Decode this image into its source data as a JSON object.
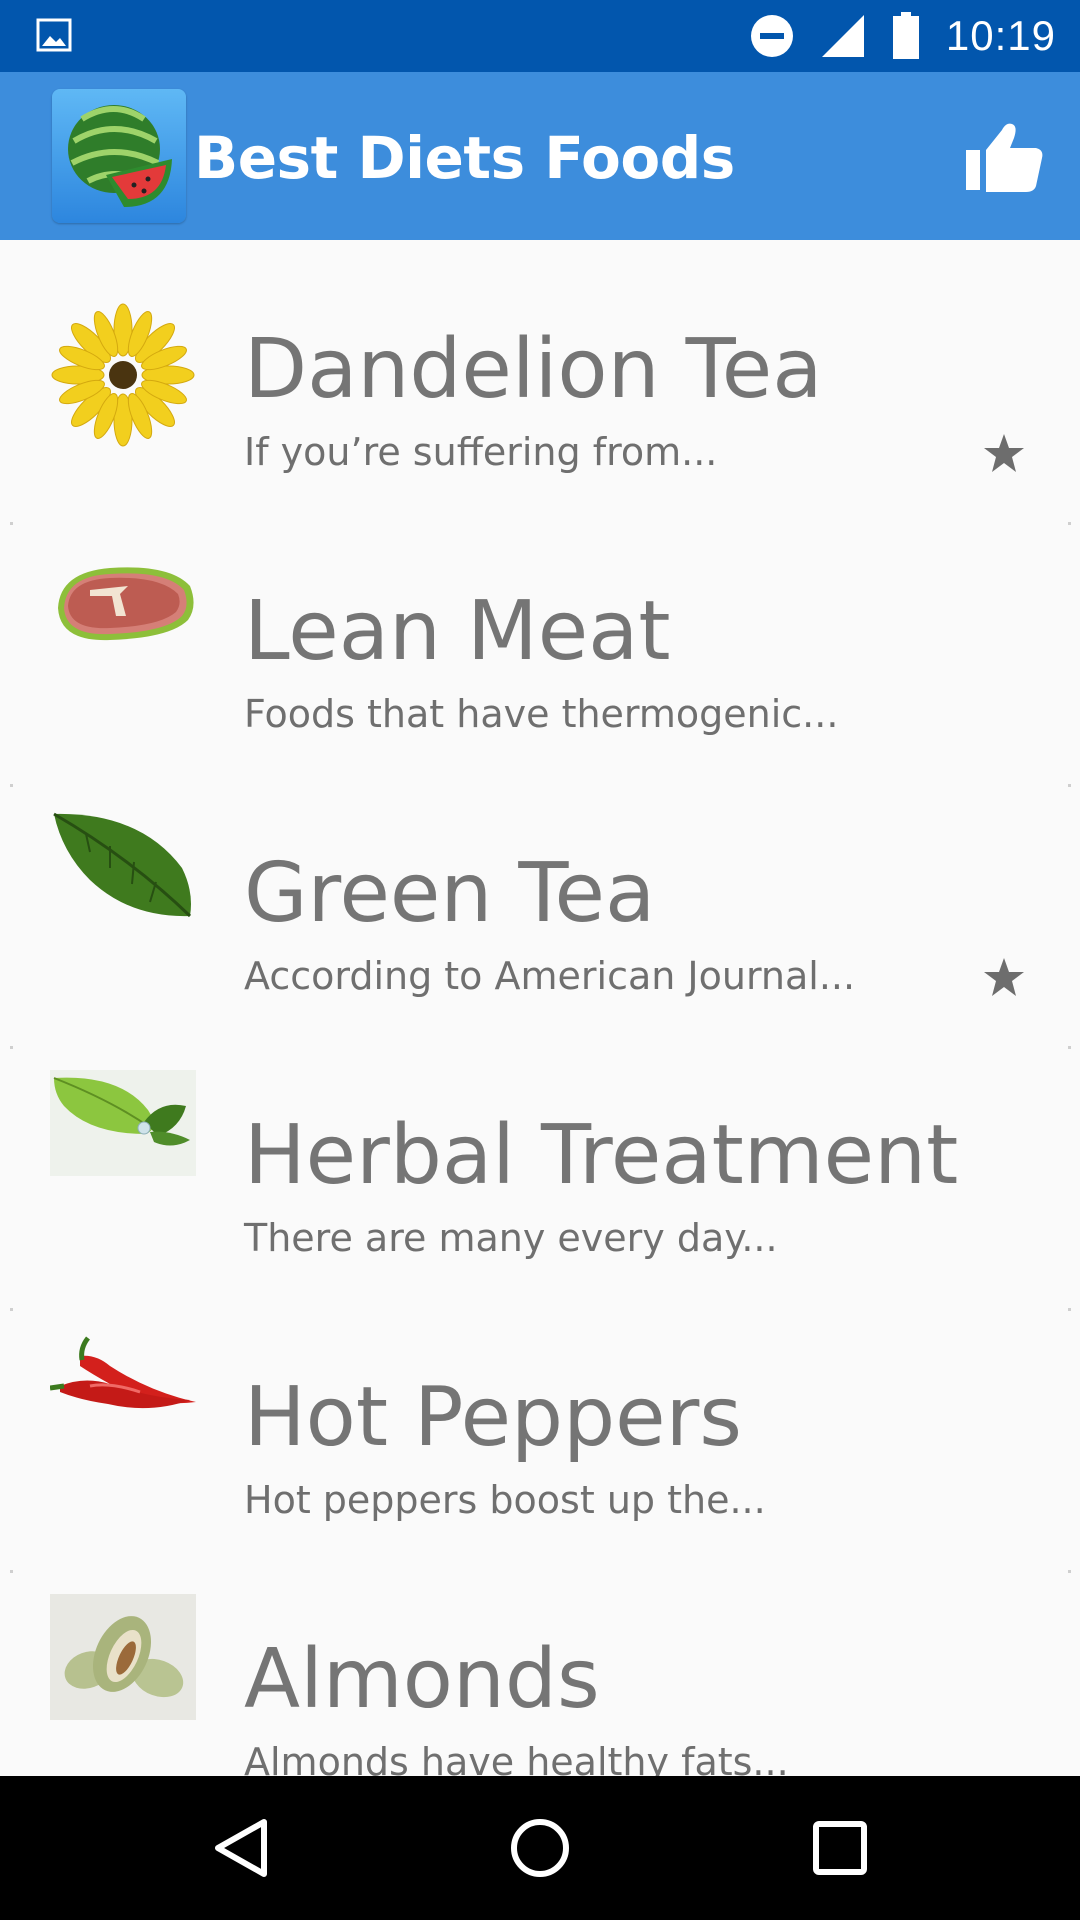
{
  "status_bar": {
    "time": "10:19",
    "icons": [
      "image-icon",
      "do-not-disturb-icon",
      "signal-icon",
      "battery-icon"
    ]
  },
  "app_bar": {
    "title": "Best Diets Foods",
    "logo_icon": "watermelon-icon",
    "action_icon": "thumbs-up-icon"
  },
  "items": [
    {
      "title": "Dandelion Tea",
      "desc": "If you’re suffering from...",
      "icon": "dandelion-flower-icon",
      "starred": true
    },
    {
      "title": "Lean Meat",
      "desc": "Foods that have thermogenic...",
      "icon": "steak-icon",
      "starred": false
    },
    {
      "title": "Green Tea",
      "desc": "According to American Journal...",
      "icon": "green-leaf-icon",
      "starred": true
    },
    {
      "title": "Herbal Treatment",
      "desc": "There are many every day...",
      "icon": "herbal-leaf-icon",
      "starred": false
    },
    {
      "title": "Hot Peppers",
      "desc": "Hot peppers boost up the...",
      "icon": "chili-pepper-icon",
      "starred": false
    },
    {
      "title": "Almonds",
      "desc": "Almonds have healthy fats...",
      "icon": "almonds-icon",
      "starred": false
    }
  ],
  "nav_bar": {
    "buttons": [
      "back-icon",
      "home-icon",
      "recents-icon"
    ]
  },
  "colors": {
    "status_bar": "#0256ad",
    "app_bar": "#3d8ddc",
    "background": "#fafafa",
    "title_text": "#757575",
    "star": "#6d6d6d"
  }
}
